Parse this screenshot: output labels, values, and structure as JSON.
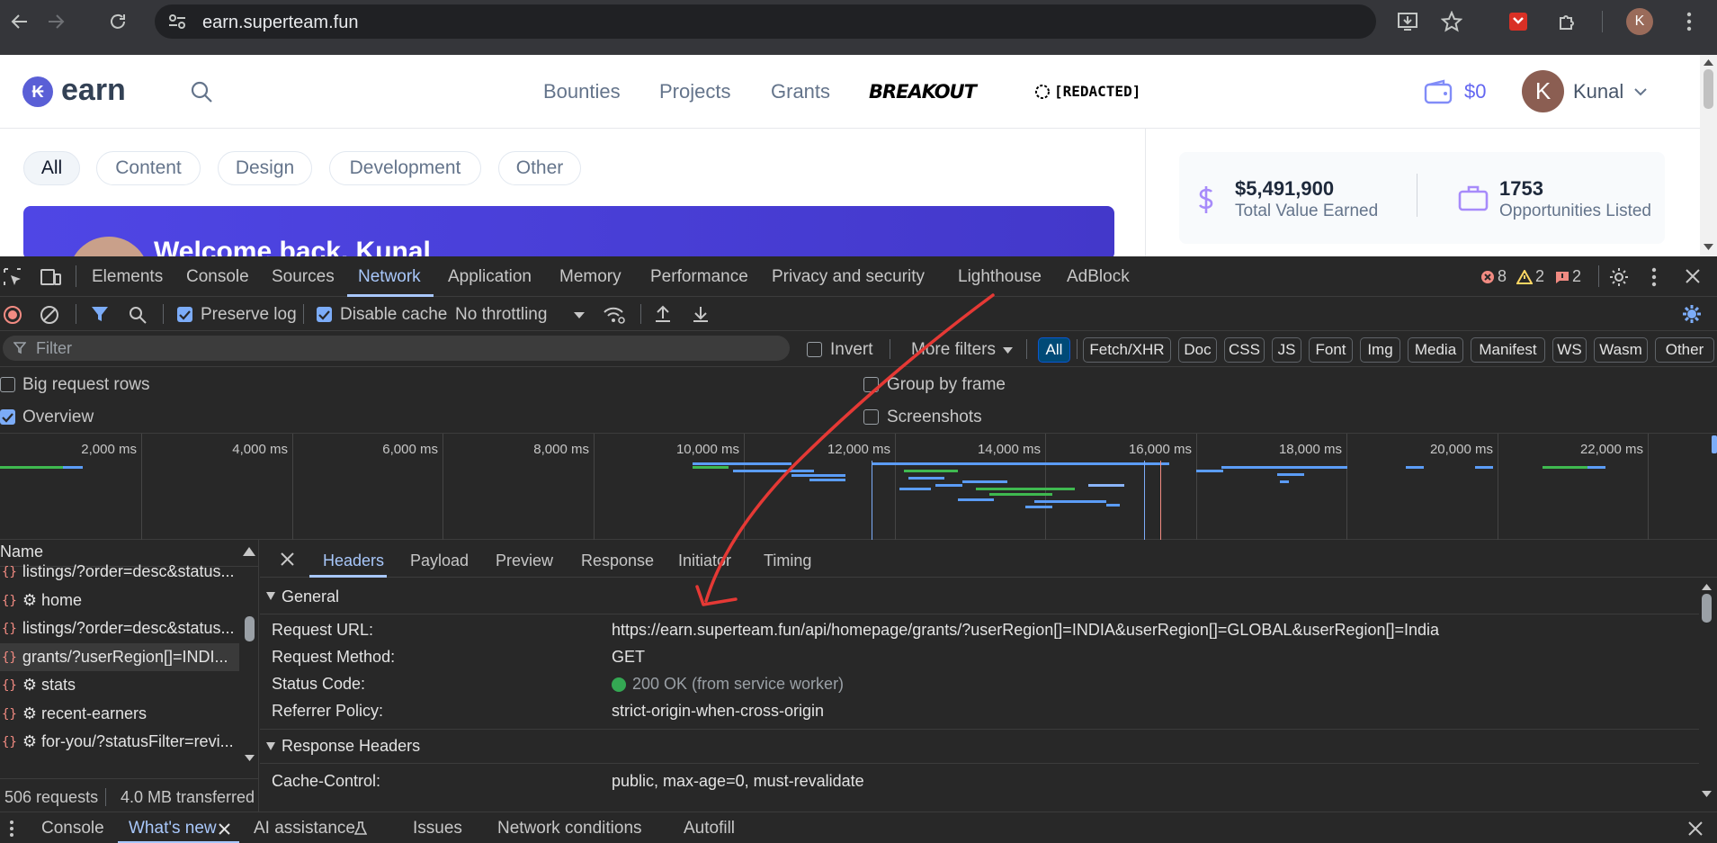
{
  "browser": {
    "url": "earn.superteam.fun",
    "avatar_letter": "K"
  },
  "site": {
    "logo_text": "earn",
    "nav": [
      "Bounties",
      "Projects",
      "Grants"
    ],
    "breakout_label": "BREAKOUT",
    "redacted_label": "[REDACTED]",
    "wallet_amount": "$0",
    "user_initial": "K",
    "user_name": "Kunal",
    "filter_pills": [
      "All",
      "Content",
      "Design",
      "Development",
      "Other"
    ],
    "banner_text": "Welcome back, Kunal",
    "stats": {
      "total_value": "$5,491,900",
      "total_value_label": "Total Value Earned",
      "opportunities": "1753",
      "opportunities_label": "Opportunities Listed"
    }
  },
  "devtools": {
    "tabs": [
      "Elements",
      "Console",
      "Sources",
      "Network",
      "Application",
      "Memory",
      "Performance",
      "Privacy and security",
      "Lighthouse",
      "AdBlock"
    ],
    "badges": {
      "errors": "8",
      "warnings": "2",
      "issues": "2"
    },
    "toolbar": {
      "preserve_log": "Preserve log",
      "disable_cache": "Disable cache",
      "throttling": "No throttling"
    },
    "filter": {
      "placeholder": "Filter",
      "invert": "Invert",
      "more_filters": "More filters",
      "chips": [
        "All",
        "Fetch/XHR",
        "Doc",
        "CSS",
        "JS",
        "Font",
        "Img",
        "Media",
        "Manifest",
        "WS",
        "Wasm",
        "Other"
      ]
    },
    "options": {
      "big_rows": "Big request rows",
      "overview": "Overview",
      "group_by_frame": "Group by frame",
      "screenshots": "Screenshots"
    },
    "timeline_ticks": [
      "2,000 ms",
      "4,000 ms",
      "6,000 ms",
      "8,000 ms",
      "10,000 ms",
      "12,000 ms",
      "14,000 ms",
      "16,000 ms",
      "18,000 ms",
      "20,000 ms",
      "22,000 ms"
    ],
    "requests": {
      "header": "Name",
      "rows": [
        {
          "name": "listings/?order=desc&status..."
        },
        {
          "name": "⚙ home"
        },
        {
          "name": "listings/?order=desc&status..."
        },
        {
          "name": "grants/?userRegion[]=INDI..."
        },
        {
          "name": "⚙ stats"
        },
        {
          "name": "⚙ recent-earners"
        },
        {
          "name": "⚙ for-you/?statusFilter=revi..."
        }
      ],
      "count": "506 requests",
      "transferred": "4.0 MB transferred"
    },
    "detail": {
      "tabs": [
        "Headers",
        "Payload",
        "Preview",
        "Response",
        "Initiator",
        "Timing"
      ],
      "general_title": "General",
      "request_url_key": "Request URL:",
      "request_url": "https://earn.superteam.fun/api/homepage/grants/?userRegion[]=INDIA&userRegion[]=GLOBAL&userRegion[]=India",
      "method_key": "Request Method:",
      "method": "GET",
      "status_key": "Status Code:",
      "status": "200 OK (from service worker)",
      "referrer_key": "Referrer Policy:",
      "referrer": "strict-origin-when-cross-origin",
      "response_headers_title": "Response Headers",
      "cache_key": "Cache-Control:",
      "cache_value": "public, max-age=0, must-revalidate"
    },
    "drawer": [
      "Console",
      "What's new",
      "AI assistance",
      "Issues",
      "Network conditions",
      "Autofill"
    ]
  },
  "colors": {
    "accent": "#a8c7fa",
    "brand": "#6366f1",
    "status_ok": "#34a853",
    "error": "#f28b82",
    "annotation": "#e53935"
  }
}
